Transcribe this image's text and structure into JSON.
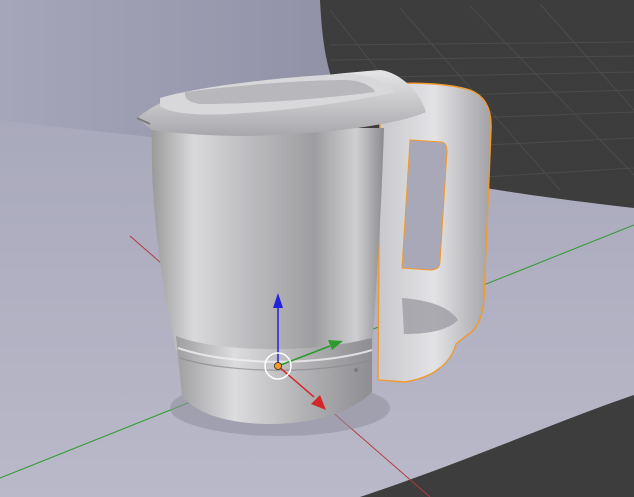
{
  "viewport": {
    "mode": "3d-viewport",
    "object": "electric-kettle-mesh",
    "selected_part": "kettle-handle",
    "gizmo": "translate"
  },
  "colors": {
    "background": "#3d3d3d",
    "grid_line": "#4a4a4a",
    "floor": "#b4b4c4",
    "backdrop": "#9a9aae",
    "axis_x": "#d42828",
    "axis_y": "#2e9a2e",
    "axis_z": "#2222dd",
    "selection_outline": "#f29a2e",
    "origin": "#f29a2e"
  },
  "icons": {
    "gizmo_x": "arrow-x-icon",
    "gizmo_y": "arrow-y-icon",
    "gizmo_z": "arrow-z-icon",
    "cursor": "3d-cursor-icon"
  }
}
